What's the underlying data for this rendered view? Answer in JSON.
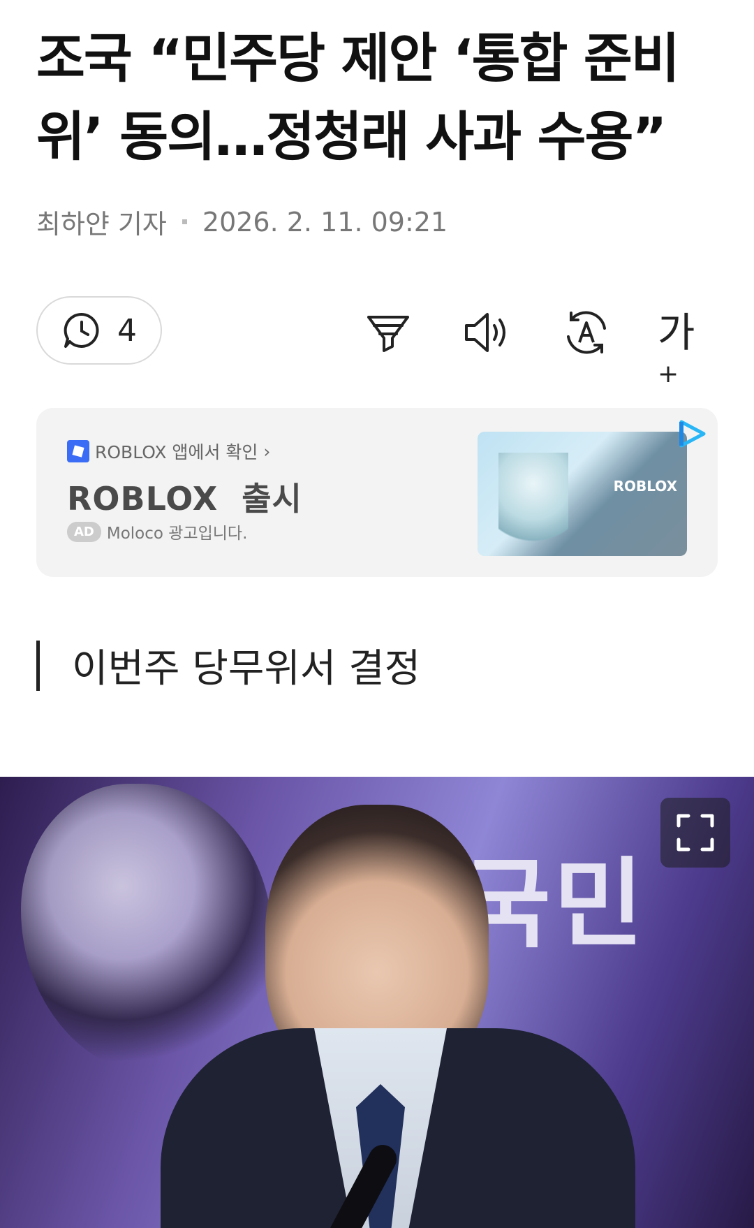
{
  "article": {
    "headline_line1": "조국 “민주당 제안 ‘통합 준비",
    "headline_line2": "위’ 동의…정청래 사과 수용”",
    "reporter": "최하얀 기자",
    "published": "2026. 2. 11. 09:21",
    "subheading": "이번주 당무위서 결정"
  },
  "toolbar": {
    "comment_count": "4",
    "icons": [
      "comment-clock-icon",
      "summary-filter-icon",
      "speaker-icon",
      "translate-icon",
      "font-size-icon"
    ],
    "font_size_label": "가",
    "font_size_plus": "+"
  },
  "ad": {
    "source_label": "ROBLOX 앱에서 확인",
    "source_chevron": "›",
    "title": "ROBLOX  출시",
    "badge": "AD",
    "advertiser": "Moloco 광고입니다.",
    "image_brand": "ROBLOX"
  },
  "photo": {
    "banner_text": "국민"
  }
}
